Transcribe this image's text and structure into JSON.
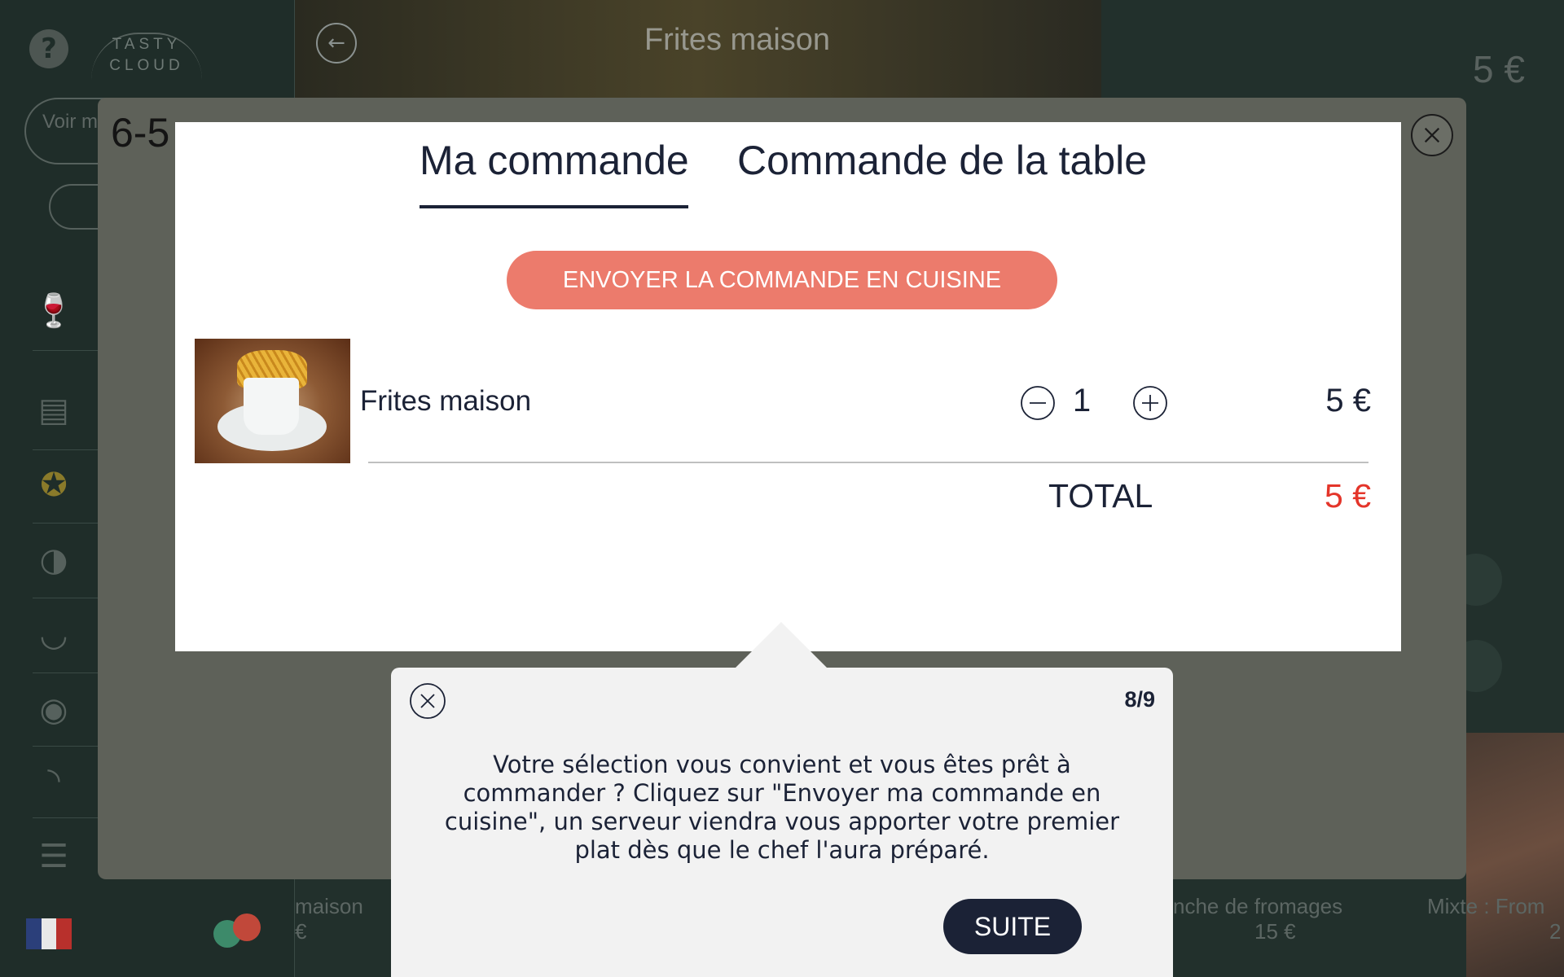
{
  "background": {
    "product_title": "Frites maison",
    "product_price": "5 €",
    "view_menu_label": "Voir m",
    "cards": [
      {
        "name": "maison",
        "price": "€"
      },
      {
        "name": "nche de fromages",
        "price": "15 €"
      },
      {
        "name": "Mixte : From",
        "price": "2"
      }
    ]
  },
  "modal": {
    "table_number": "6-5",
    "tabs": [
      {
        "label": "Ma commande",
        "active": true
      },
      {
        "label": "Commande de la table",
        "active": false
      }
    ],
    "send_button": "ENVOYER LA COMMANDE EN CUISINE",
    "items": [
      {
        "name": "Frites maison",
        "quantity": "1",
        "price": "5 €"
      }
    ],
    "total_label": "TOTAL",
    "total_value": "5 €"
  },
  "tour": {
    "step": "8/9",
    "text": "Votre sélection vous convient et vous êtes prêt à commander ? Cliquez sur \"Envoyer ma commande en cuisine\", un serveur viendra vous apporter votre premier plat dès que le chef l'aura préparé.",
    "next_button": "SUITE"
  },
  "colors": {
    "accent_coral": "#ec7b6c",
    "navy": "#1b2236",
    "total_red": "#e4352a",
    "tooltip_bg": "#f2f2f2"
  },
  "icons": [
    "help-icon",
    "back-arrow-icon",
    "close-icon",
    "minus-icon",
    "plus-icon",
    "wine-glass-icon",
    "menu-book-icon",
    "skewer-icon",
    "pie-icon",
    "cloche-icon",
    "cupcake-icon",
    "croissant-icon",
    "burger-icon"
  ]
}
